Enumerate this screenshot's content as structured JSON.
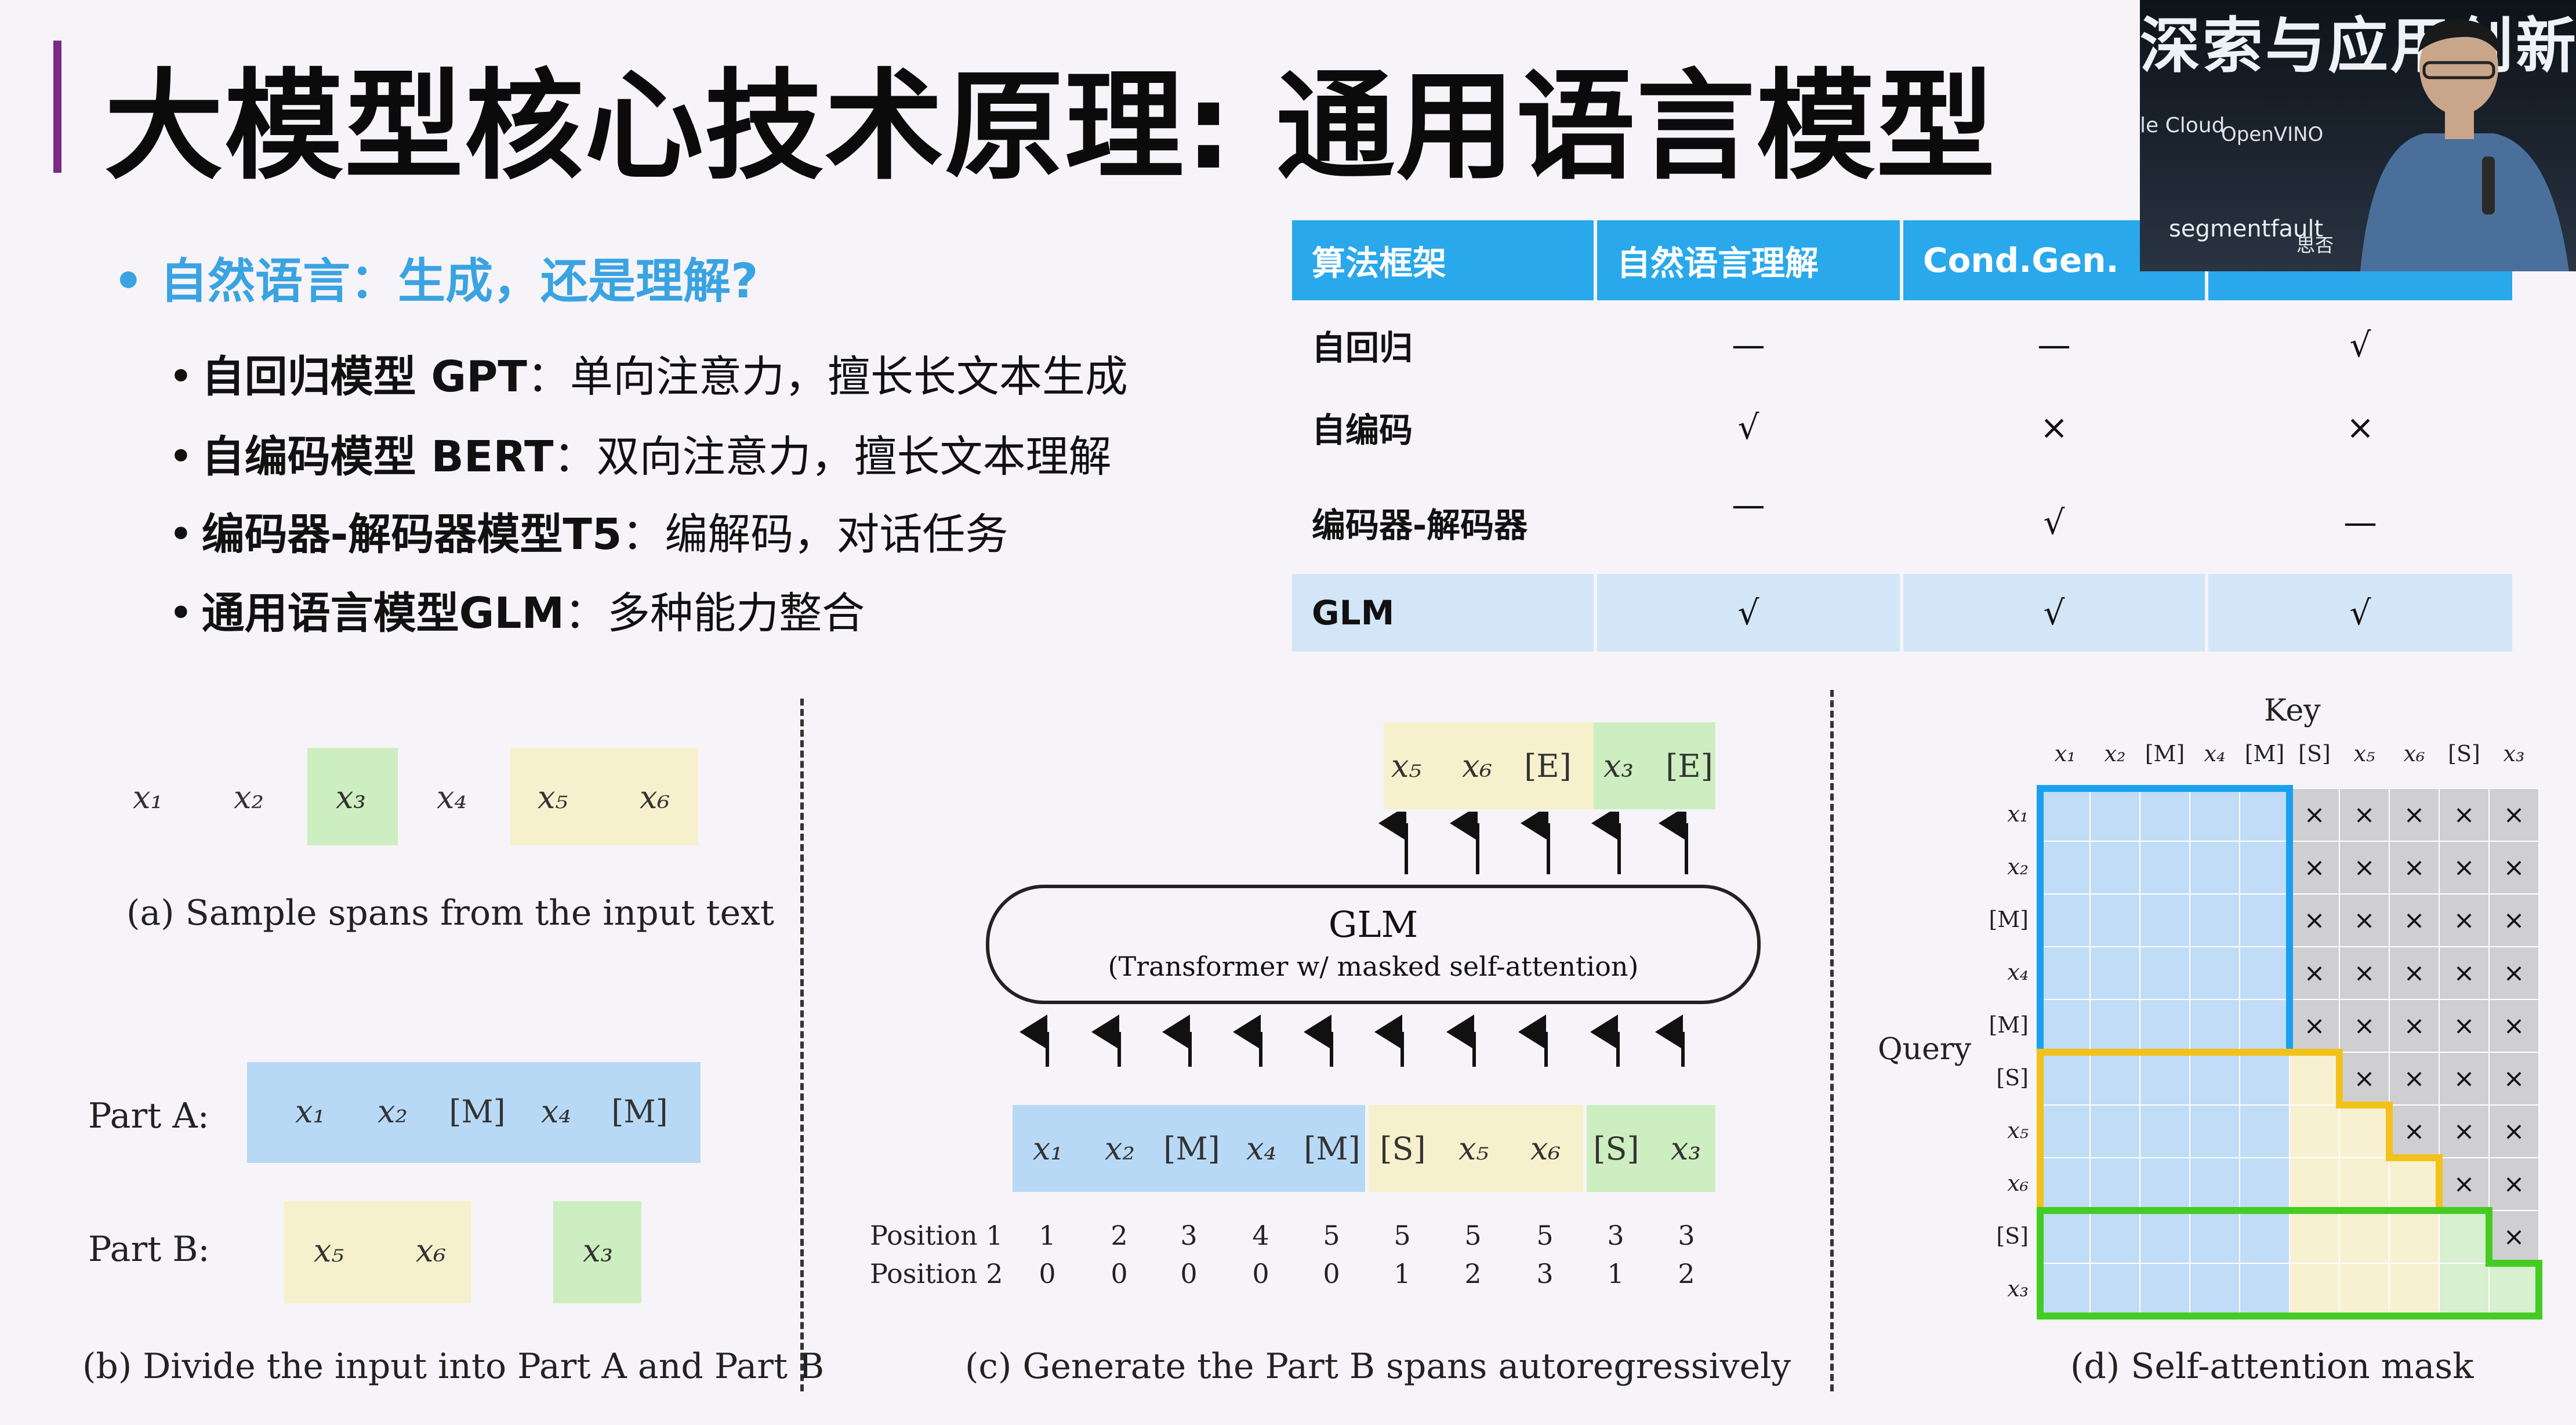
{
  "title": "大模型核心技术原理: 通用语言模型",
  "subtitle": "• 自然语言：生成，还是理解?",
  "bullets": [
    {
      "bold": "自回归模型 GPT",
      "rest": "：单向注意力，擅长长文本生成"
    },
    {
      "bold": "自编码模型 BERT",
      "rest": "：双向注意力，擅长文本理解"
    },
    {
      "bold": "编码器-解码器模型T5",
      "rest": "：编解码，对话任务"
    },
    {
      "bold": "通用语言模型GLM",
      "rest": "：多种能力整合"
    }
  ],
  "table": {
    "headers": [
      "算法框架",
      "自然语言理解",
      "Cond.Gen.",
      ""
    ],
    "rows": [
      [
        "自回归",
        "—",
        "—",
        "√"
      ],
      [
        "自编码",
        "√",
        "×",
        "×"
      ],
      [
        "编码器-解码器",
        "—",
        "√",
        "—"
      ],
      [
        "GLM",
        "√",
        "√",
        "√"
      ]
    ]
  },
  "webcam": {
    "banner": "深索与应用创新",
    "logos": [
      "le Cloud",
      "OpenVINO",
      "segmentfault",
      "思否"
    ]
  },
  "figure": {
    "a": {
      "tokens": [
        "x1",
        "x2",
        "x3",
        "x4",
        "x5",
        "x6"
      ],
      "caption": "(a)  Sample spans from the input text"
    },
    "b": {
      "part_a_label": "Part A:",
      "part_b_label": "Part B:",
      "part_a_tokens": [
        "x1",
        "x2",
        "[M]",
        "x4",
        "[M]"
      ],
      "part_b_tokens": [
        "x5",
        "x6",
        "x3"
      ],
      "caption": "(b)  Divide the input into Part A and Part B"
    },
    "c": {
      "output_tokens": [
        "x5",
        "x6",
        "[E]",
        "x3",
        "[E]"
      ],
      "glm_title": "GLM",
      "glm_sub": "(Transformer w/ masked self-attention)",
      "input_tokens": [
        "x1",
        "x2",
        "[M]",
        "x4",
        "[M]",
        "[S]",
        "x5",
        "x6",
        "[S]",
        "x3"
      ],
      "position1_label": "Position 1",
      "position2_label": "Position 2",
      "position1": [
        "1",
        "2",
        "3",
        "4",
        "5",
        "5",
        "5",
        "5",
        "3",
        "3"
      ],
      "position2": [
        "0",
        "0",
        "0",
        "0",
        "0",
        "1",
        "2",
        "3",
        "1",
        "2"
      ],
      "caption": "(c)  Generate the Part B spans autoregressively"
    },
    "d": {
      "key_label": "Key",
      "query_label": "Query",
      "tokens": [
        "x1",
        "x2",
        "[M]",
        "x4",
        "[M]",
        "[S]",
        "x5",
        "x6",
        "[S]",
        "x3"
      ],
      "caption": "(d)  Self-attention mask"
    }
  },
  "colors": {
    "accent_bar": "#7a2a86",
    "subtitle": "#3aa3e2",
    "table_header": "#29a8ec",
    "glm_row": "#d3e6f8",
    "part_a": "#b8d9f6",
    "part_b_yellow": "#f6f0cc",
    "part_b_green": "#cdeec0",
    "mask_blue_border": "#1aa0f0",
    "mask_yellow_border": "#f2c21a",
    "mask_green_border": "#44cc22"
  }
}
